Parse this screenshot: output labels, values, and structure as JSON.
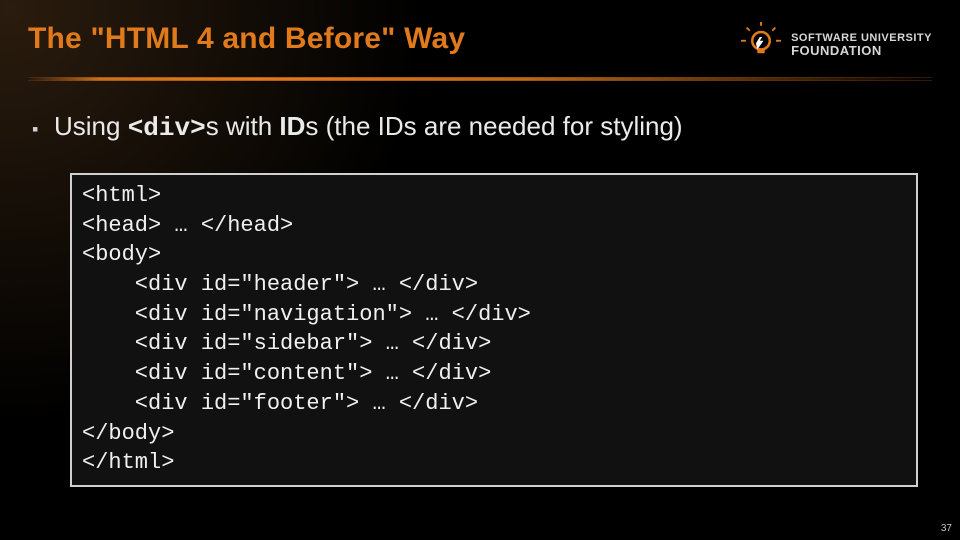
{
  "header": {
    "title": "The \"HTML 4 and Before\" Way",
    "logo": {
      "line1": "SOFTWARE UNIVERSITY",
      "line2": "FOUNDATION"
    }
  },
  "bullet": {
    "marker": "▪",
    "prefix": "Using ",
    "code1": "<div>",
    "mid": "s with ",
    "bold1": "ID",
    "suffix": "s (the IDs are needed for styling)"
  },
  "code_block": "<html>\n<head> … </head>\n<body>\n    <div id=\"header\"> … </div>\n    <div id=\"navigation\"> … </div>\n    <div id=\"sidebar\"> … </div>\n    <div id=\"content\"> … </div>\n    <div id=\"footer\"> … </div>\n</body>\n</html>",
  "page_number": "37"
}
